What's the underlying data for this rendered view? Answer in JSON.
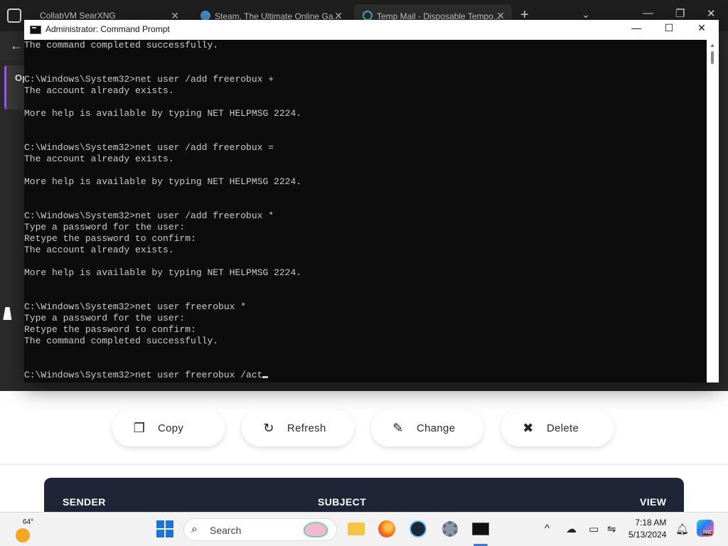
{
  "browser": {
    "tabs": [
      {
        "label": "CollabVM SearXNG"
      },
      {
        "label": "Steam, The Ultimate Online Ga..."
      },
      {
        "label": "Temp Mail - Disposable Tempo..."
      }
    ],
    "new_tab": "+",
    "tab_menu": "⌄",
    "controls": {
      "minimize": "—",
      "maximize": "❐",
      "close": "✕"
    },
    "back": "←",
    "side_card_text": "Op"
  },
  "cmd": {
    "title": "Administrator: Command Prompt",
    "controls": {
      "minimize": "—",
      "maximize": "☐",
      "close": "✕"
    },
    "lines": [
      "The command completed successfully.",
      "",
      "",
      "C:\\Windows\\System32>net user /add freerobux +",
      "The account already exists.",
      "",
      "More help is available by typing NET HELPMSG 2224.",
      "",
      "",
      "C:\\Windows\\System32>net user /add freerobux =",
      "The account already exists.",
      "",
      "More help is available by typing NET HELPMSG 2224.",
      "",
      "",
      "C:\\Windows\\System32>net user /add freerobux *",
      "Type a password for the user:",
      "Retype the password to confirm:",
      "The account already exists.",
      "",
      "More help is available by typing NET HELPMSG 2224.",
      "",
      "",
      "C:\\Windows\\System32>net user freerobux *",
      "Type a password for the user:",
      "Retype the password to confirm:",
      "The command completed successfully.",
      "",
      ""
    ],
    "prompt_input": "C:\\Windows\\System32>net user freerobux /act"
  },
  "tempmail": {
    "actions": [
      {
        "label": "Copy",
        "icon": "copy-icon",
        "glyph": "❐"
      },
      {
        "label": "Refresh",
        "icon": "refresh-icon",
        "glyph": "↻"
      },
      {
        "label": "Change",
        "icon": "pen-icon",
        "glyph": "✎"
      },
      {
        "label": "Delete",
        "icon": "close-icon",
        "glyph": "✖"
      }
    ],
    "table_headers": {
      "sender": "SENDER",
      "subject": "SUBJECT",
      "view": "VIEW"
    }
  },
  "taskbar": {
    "weather_temp": "64°",
    "search_label": "Search",
    "tray": {
      "chevron": "^",
      "time": "7:18 AM",
      "date": "5/13/2024"
    },
    "copilot_badge": "PRE"
  },
  "colors": {
    "cmd_bg": "#0c0c0c",
    "cmd_text": "#cccccc",
    "mail_header": "#1e2536",
    "accent": "#1e73d6"
  }
}
